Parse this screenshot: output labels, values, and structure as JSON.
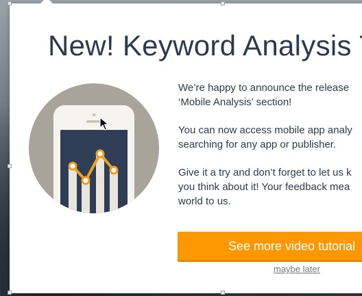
{
  "modal": {
    "title": "New! Keyword Analysis T",
    "paragraphs": [
      "We’re happy to announce the release",
      "‘Mobile Analysis’ section!",
      "You can now access mobile app analy",
      "searching for any app or publisher.",
      "Give it a try and don’t forget to let us k",
      "you think about it! Your feedback mea",
      "world to us."
    ],
    "cta_label": "See more video tutorial",
    "later_label": "maybe later"
  },
  "colors": {
    "accent": "#ff9800",
    "title_text": "#2b3a4f",
    "circle": "#a8a49c",
    "phone_screen": "#2f3d56",
    "chart_line": "#f0a020"
  },
  "icons": [
    "phone-illustration",
    "mouse-cursor-icon"
  ]
}
